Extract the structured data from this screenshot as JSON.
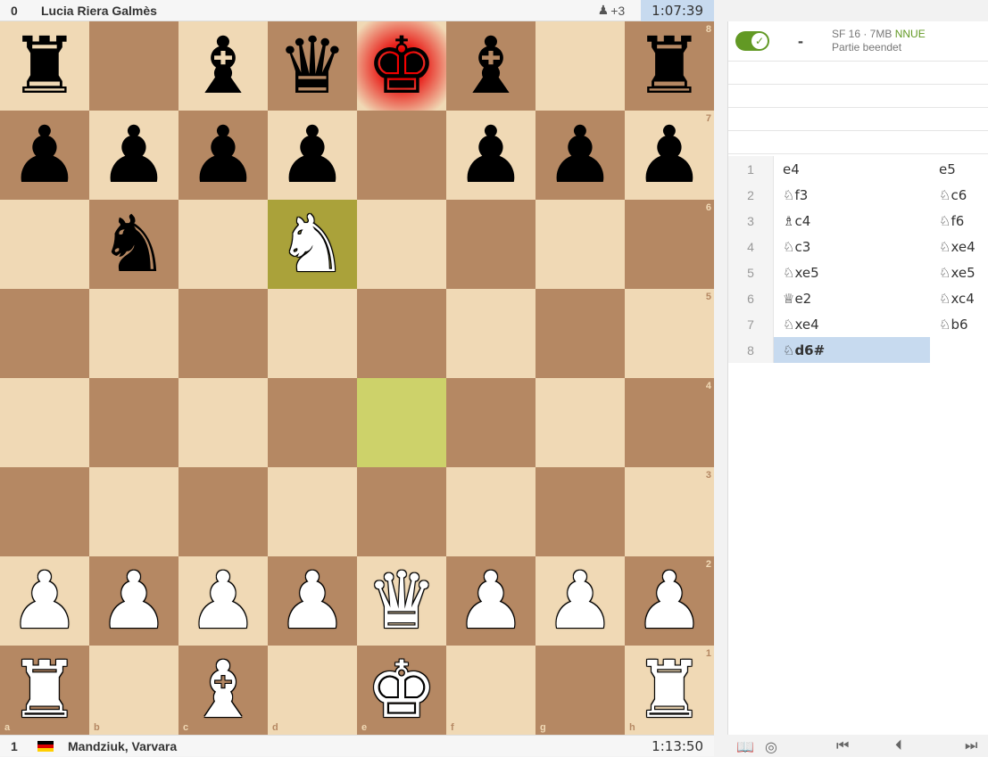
{
  "top_player": {
    "score": "0",
    "name": "Lucia Riera Galmès",
    "material": "+3",
    "clock": "1:07:39"
  },
  "bottom_player": {
    "score": "1",
    "name": "Mandziuk, Varvara",
    "clock": "1:13:50"
  },
  "board": {
    "ranks": [
      "8",
      "7",
      "6",
      "5",
      "4",
      "3",
      "2",
      "1"
    ],
    "files": [
      "a",
      "b",
      "c",
      "d",
      "e",
      "f",
      "g",
      "h"
    ],
    "position": [
      [
        "br",
        "",
        "bb",
        "bq",
        "bk",
        "bb",
        "",
        "br"
      ],
      [
        "bp",
        "bp",
        "bp",
        "bp",
        "",
        "bp",
        "bp",
        "bp"
      ],
      [
        "",
        "bn",
        "",
        "wn",
        "",
        "",
        "",
        ""
      ],
      [
        "",
        "",
        "",
        "",
        "",
        "",
        "",
        ""
      ],
      [
        "",
        "",
        "",
        "",
        "",
        "",
        "",
        ""
      ],
      [
        "",
        "",
        "",
        "",
        "",
        "",
        "",
        ""
      ],
      [
        "wp",
        "wp",
        "wp",
        "wp",
        "wq",
        "wp",
        "wp",
        "wp"
      ],
      [
        "wr",
        "",
        "wb",
        "",
        "wk",
        "",
        "",
        "wr"
      ]
    ],
    "last_move": [
      "e4",
      "d6"
    ],
    "check_square": "e8"
  },
  "ceval": {
    "score": "-",
    "engine": "SF 16 · 7MB",
    "nnue": "NNUE",
    "status": "Partie beendet"
  },
  "moves": [
    {
      "num": "1",
      "white": "e4",
      "black": "e5"
    },
    {
      "num": "2",
      "white": "♘f3",
      "black": "♘c6"
    },
    {
      "num": "3",
      "white": "♗c4",
      "black": "♘f6"
    },
    {
      "num": "4",
      "white": "♘c3",
      "black": "♘xe4"
    },
    {
      "num": "5",
      "white": "♘xe5",
      "black": "♘xe5"
    },
    {
      "num": "6",
      "white": "♕e2",
      "black": "♘xc4"
    },
    {
      "num": "7",
      "white": "♘xe4",
      "black": "♘b6"
    },
    {
      "num": "8",
      "white": "♘d6#",
      "black": ""
    }
  ],
  "controls": {
    "book": "📖",
    "radar": "◎",
    "first": "⏮",
    "prev": "⏴",
    "next": "⏭"
  }
}
